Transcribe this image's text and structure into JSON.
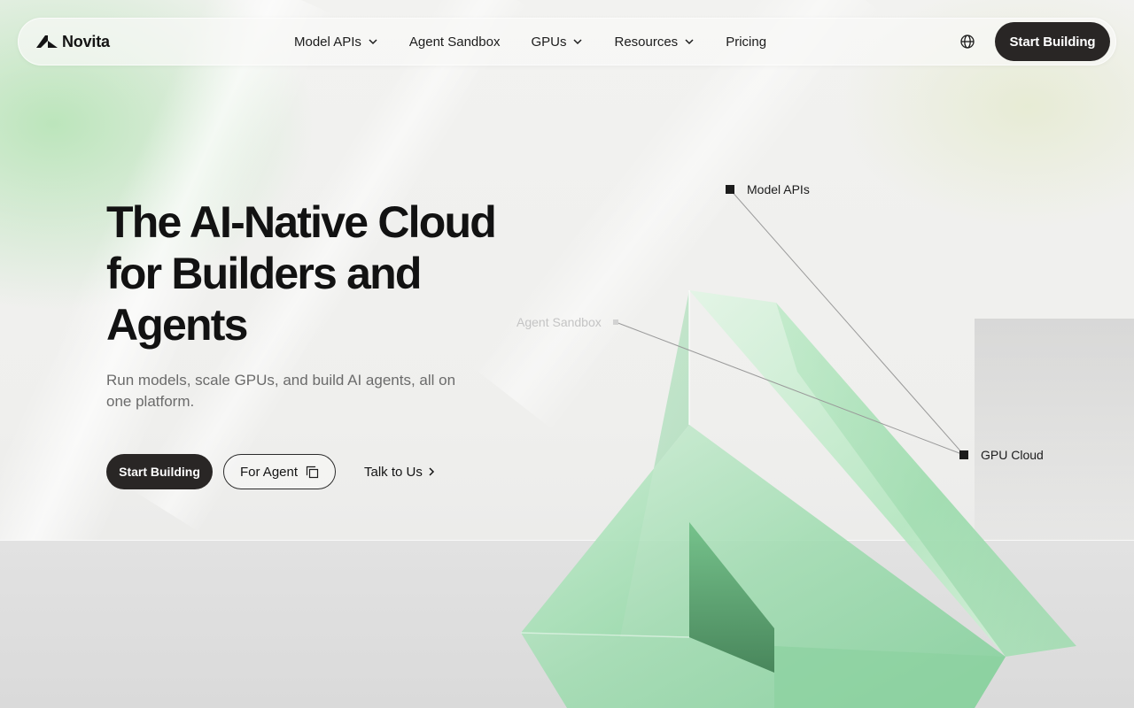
{
  "brand": {
    "name": "Novita"
  },
  "nav": {
    "items": [
      {
        "label": "Model APIs",
        "has_dropdown": true
      },
      {
        "label": "Agent Sandbox",
        "has_dropdown": false
      },
      {
        "label": "GPUs",
        "has_dropdown": true
      },
      {
        "label": "Resources",
        "has_dropdown": true
      },
      {
        "label": "Pricing",
        "has_dropdown": false
      }
    ],
    "language_icon": "globe-icon",
    "cta_label": "Start Building"
  },
  "hero": {
    "title_lines": [
      "The AI-Native Cloud",
      "for Builders and",
      "Agents"
    ],
    "subtitle": "Run models, scale GPUs, and build AI agents, all on one platform.",
    "primary_cta": "Start Building",
    "secondary_cta": "For Agent",
    "secondary_cta_icon": "copy-icon",
    "link_cta": "Talk to Us",
    "link_cta_icon": "chevron-right-icon"
  },
  "visual": {
    "nodes": [
      {
        "label": "Model APIs",
        "highlighted": true
      },
      {
        "label": "Agent Sandbox",
        "highlighted": false
      },
      {
        "label": "GPU Cloud",
        "highlighted": true
      }
    ]
  },
  "colors": {
    "dark": "#292625",
    "text": "#141414",
    "muted": "#6b6b6b",
    "accent_green": "#8fd6a0"
  }
}
